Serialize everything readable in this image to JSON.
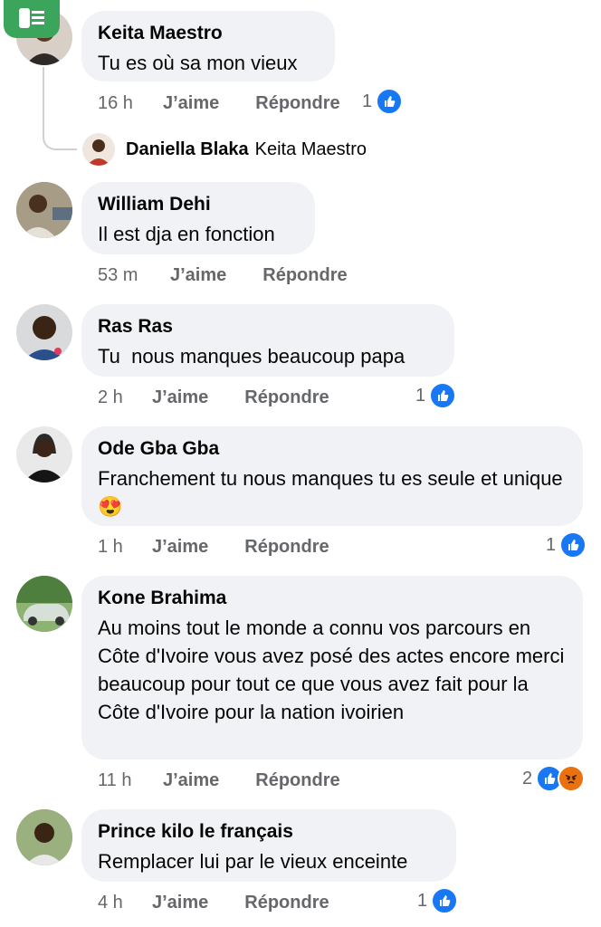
{
  "comments": [
    {
      "author": "Keita Maestro",
      "text": "Tu es où sa mon vieux",
      "time": "16 h",
      "like": "J’aime",
      "reply": "Répondre",
      "reactions": "1"
    },
    {
      "author": "William Dehi",
      "text": "Il est dja en fonction",
      "time": "53 m",
      "like": "J’aime",
      "reply": "Répondre",
      "reactions": ""
    },
    {
      "author": "Ras Ras",
      "text": "Tu  nous manques beaucoup papa",
      "time": "2 h",
      "like": "J’aime",
      "reply": "Répondre",
      "reactions": "1"
    },
    {
      "author": "Ode Gba Gba",
      "text": "Franchement tu nous manques tu es seule et unique 😍",
      "time": "1 h",
      "like": "J’aime",
      "reply": "Répondre",
      "reactions": "1"
    },
    {
      "author": "Kone Brahima",
      "text": "Au moins tout le monde a connu vos parcours en Côte d'Ivoire vous avez posé des actes encore merci beaucoup pour tout ce que vous avez fait pour la Côte d'Ivoire pour la nation ivoirien",
      "time": "11 h",
      "like": "J’aime",
      "reply": "Répondre",
      "reactions": "2"
    },
    {
      "author": "Prince kilo le français",
      "text": "Remplacer lui par le vieux enceinte",
      "time": "4 h",
      "like": "J’aime",
      "reply": "Répondre",
      "reactions": "1"
    }
  ],
  "reply_preview": {
    "author": "Daniella Blaka",
    "reply_to": "Keita Maestro"
  },
  "colors": {
    "bubble": "#f0f2f5",
    "meta": "#65676b",
    "like_blue": "#1877f2",
    "angry_orange": "#e9710f"
  }
}
